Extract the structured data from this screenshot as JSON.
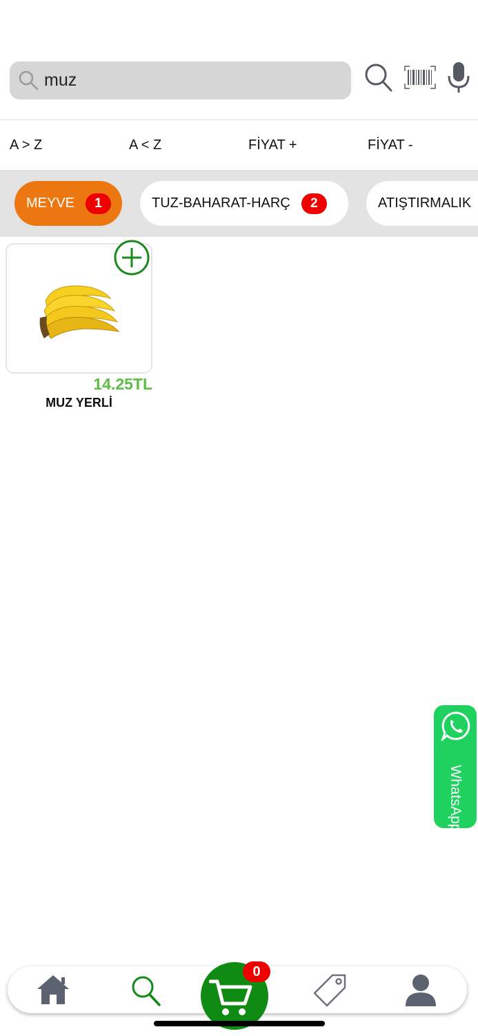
{
  "search": {
    "value": "muz",
    "icons": [
      "magnifier-icon",
      "search-icon",
      "barcode-icon",
      "microphone-icon"
    ]
  },
  "sort": [
    "A > Z",
    "A < Z",
    "FİYAT +",
    "FİYAT -"
  ],
  "categories": [
    {
      "label": "MEYVE",
      "count": "1",
      "active": true
    },
    {
      "label": "TUZ-BAHARAT-HARÇ",
      "count": "2",
      "active": false
    },
    {
      "label": "ATIŞTIRMALIK",
      "count": "",
      "active": false
    }
  ],
  "products": [
    {
      "name": "MUZ YERLİ",
      "price": "14.25TL",
      "image": "banana"
    }
  ],
  "whatsapp": {
    "label": "WhatsApp"
  },
  "tabbar": {
    "icons": [
      "home-icon",
      "search-icon",
      "cart-icon",
      "tag-icon",
      "user-icon"
    ],
    "cart_count": "0"
  },
  "colors": {
    "accent": "#ec7711",
    "green": "#0f8a13",
    "price": "#5cbd47",
    "badge": "#ee0000",
    "whatsapp": "#1fd15f"
  }
}
